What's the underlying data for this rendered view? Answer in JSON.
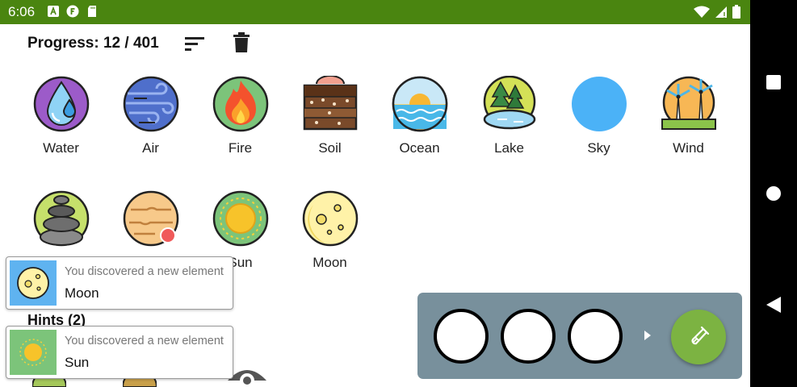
{
  "status_bar": {
    "time": "6:06",
    "background": "#4a8510",
    "left_icons": [
      "notification-a-icon",
      "notification-f-icon",
      "sd-card-icon"
    ],
    "right_icons": [
      "wifi-icon",
      "signal-icon",
      "battery-icon"
    ]
  },
  "header": {
    "progress": "Progress: 12 / 401",
    "sort_icon": "sort-icon",
    "trash_icon": "trash-icon"
  },
  "elements": [
    {
      "label": "Water",
      "icon": "water-icon"
    },
    {
      "label": "Air",
      "icon": "air-icon"
    },
    {
      "label": "Fire",
      "icon": "fire-icon"
    },
    {
      "label": "Soil",
      "icon": "soil-icon"
    },
    {
      "label": "Ocean",
      "icon": "ocean-icon"
    },
    {
      "label": "Lake",
      "icon": "lake-icon"
    },
    {
      "label": "Sky",
      "icon": "sky-icon"
    },
    {
      "label": "Wind",
      "icon": "wind-icon"
    },
    {
      "label": "",
      "icon": "stones-icon"
    },
    {
      "label": "",
      "icon": "planet-icon"
    },
    {
      "label": "Sun",
      "icon": "sun-icon"
    },
    {
      "label": "Moon",
      "icon": "moon-icon"
    }
  ],
  "hints": {
    "title": "Hints (2)"
  },
  "toasts": [
    {
      "message": "You discovered a new element",
      "element": "Moon",
      "icon": "moon-icon"
    },
    {
      "message": "You discovered a new element",
      "element": "Sun",
      "icon": "sun-icon"
    }
  ],
  "combine_panel": {
    "background": "#78909c",
    "slots": 3,
    "arrow_icon": "chevron-right-icon",
    "fab_icon": "test-tube-icon",
    "fab_color": "#7cb342"
  },
  "nav_bar": {
    "buttons": [
      "recent-apps-icon",
      "home-icon",
      "back-icon"
    ]
  }
}
